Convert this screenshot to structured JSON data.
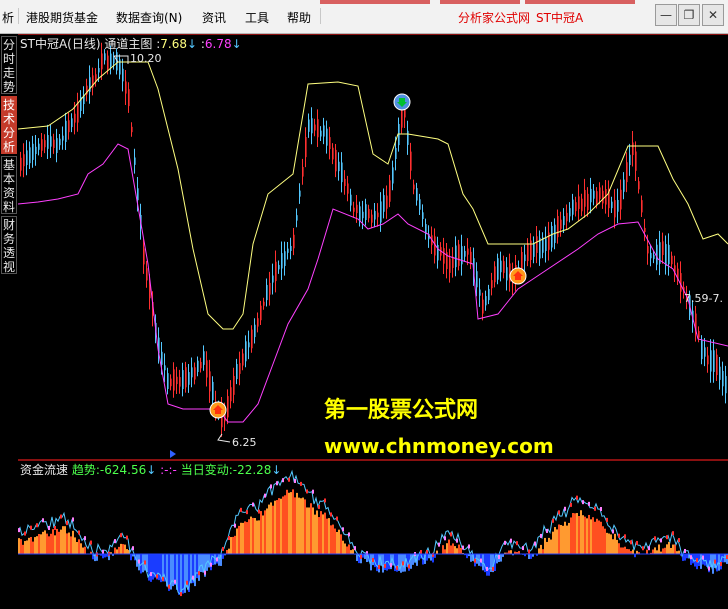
{
  "menu": {
    "items": [
      "析",
      "港股期货基金",
      "数据查询(N)",
      "资讯",
      "工具",
      "帮助"
    ],
    "site": "分析家公式网",
    "stock": "ST中冠A"
  },
  "sidebar": {
    "tabs": [
      "分时走势",
      "技术分析",
      "基本资料",
      "财务透视"
    ],
    "active": 1
  },
  "main": {
    "stock_name": "ST中冠A(日线)",
    "indicator": "通道主图",
    "sep": ":",
    "value1": "7.68",
    "value2": "6.78",
    "high_label": "10.20",
    "low_label": "6.25",
    "right_label": "7.59-7.",
    "colors": {
      "up": "#ff3030",
      "down": "#54c8ff",
      "upper": "#ffff80",
      "lower": "#ff40ff"
    }
  },
  "sub": {
    "name": "资金流速",
    "trend_label": "趋势:",
    "trend_value": "-624.56",
    "mid_text": ":-:-",
    "daily_label": "当日变动:",
    "daily_value": "-22.28",
    "colors": {
      "pos": "#ff5020",
      "neg": "#1a3cff",
      "line": "#54c8ff"
    }
  },
  "watermark": {
    "line1": "第一股票公式网",
    "line2": "www.chnmoney.com"
  }
}
